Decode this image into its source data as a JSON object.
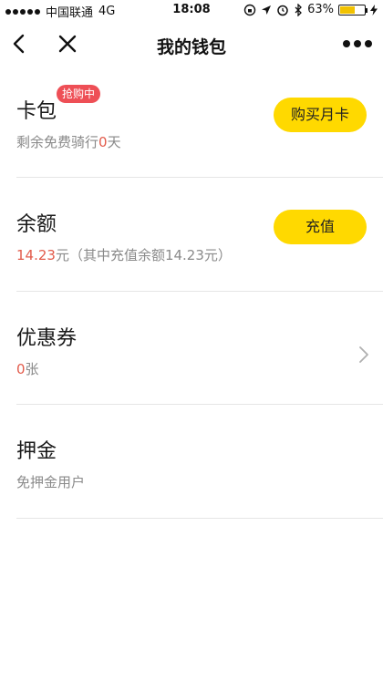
{
  "status_bar": {
    "carrier": "中国联通",
    "network": "4G",
    "time": "18:08",
    "battery_percent": "63%",
    "battery_level": 0.63
  },
  "nav": {
    "title": "我的钱包"
  },
  "card": {
    "title": "卡包",
    "badge": "抢购中",
    "sub_prefix": "剩余免费骑行",
    "sub_value": "0",
    "sub_suffix": "天",
    "button": "购买月卡"
  },
  "balance": {
    "title": "余额",
    "amount": "14.23",
    "sub_suffix": "元（其中充值余额14.23元）",
    "button": "充值"
  },
  "coupon": {
    "title": "优惠券",
    "count": "0",
    "unit": "张"
  },
  "deposit": {
    "title": "押金",
    "sub": "免押金用户"
  },
  "colors": {
    "accent_yellow": "#ffd900",
    "highlight_red": "#e25b4b",
    "badge_red": "#ee4f56"
  }
}
